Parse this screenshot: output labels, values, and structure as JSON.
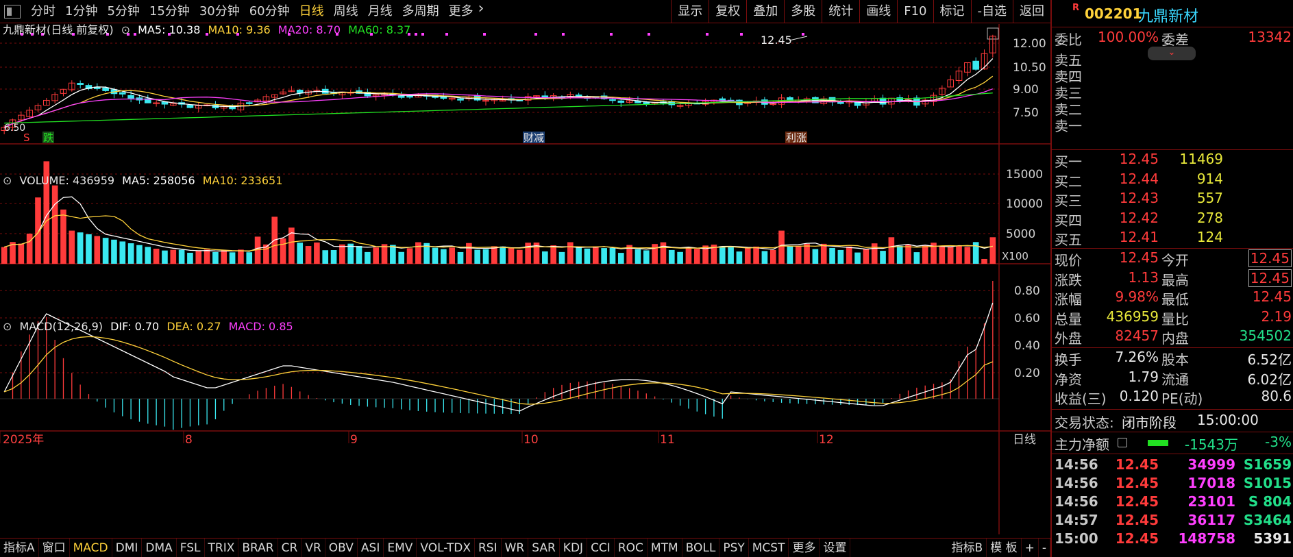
{
  "toolbar": {
    "periods": [
      "分时",
      "1分钟",
      "5分钟",
      "15分钟",
      "30分钟",
      "60分钟",
      "日线",
      "周线",
      "月线",
      "多周期",
      "更多"
    ],
    "active_period": "日线",
    "actions": [
      "显示",
      "复权",
      "叠加",
      "多股",
      "统计",
      "画线",
      "F10",
      "标记",
      "-自选",
      "返回"
    ]
  },
  "price_pane": {
    "title": "九鼎新材(日线 前复权)",
    "ma5": "MA5: 10.38",
    "ma10": "MA10: 9.36",
    "ma20": "MA20: 8.70",
    "ma60": "MA60: 8.37",
    "y_ticks": [
      "12.00",
      "10.50",
      "9.00",
      "7.50"
    ],
    "high_label": "12.45",
    "low_label": "6.50",
    "markers": [
      "S",
      "跌",
      "财减",
      "利涨"
    ]
  },
  "volume_pane": {
    "title": "VOLUME: 436959",
    "ma5": "MA5: 258056",
    "ma10": "MA10: 233651",
    "y_ticks": [
      "15000",
      "10000",
      "5000"
    ],
    "unit": "X100"
  },
  "macd_pane": {
    "title": "MACD(12,26,9)",
    "dif": "DIF: 0.70",
    "dea": "DEA: 0.27",
    "macd": "MACD: 0.85",
    "y_ticks": [
      "0.80",
      "0.60",
      "0.40",
      "0.20"
    ]
  },
  "x_axis": {
    "labels": [
      "2025年",
      "8",
      "9",
      "10",
      "11",
      "12"
    ],
    "period_label": "日线"
  },
  "bottom_tabs": [
    "指标A",
    "窗口",
    "MACD",
    "DMI",
    "DMA",
    "FSL",
    "TRIX",
    "BRAR",
    "CR",
    "VR",
    "OBV",
    "ASI",
    "EMV",
    "VOL-TDX",
    "RSI",
    "WR",
    "SAR",
    "KDJ",
    "CCI",
    "ROC",
    "MTM",
    "BOLL",
    "PSY",
    "MCST",
    "更多",
    "设置"
  ],
  "bottom_active": "MACD",
  "bottom_right": [
    "指标B",
    "模 板",
    "+",
    "-"
  ],
  "stock": {
    "badge": "R",
    "code": "002201",
    "name": "九鼎新材"
  },
  "order_ratio": {
    "label1": "委比",
    "value1": "100.00%",
    "label2": "委差",
    "value2": "13342"
  },
  "asks": [
    {
      "label": "卖五",
      "price": "",
      "vol": ""
    },
    {
      "label": "卖四",
      "price": "",
      "vol": ""
    },
    {
      "label": "卖三",
      "price": "",
      "vol": ""
    },
    {
      "label": "卖二",
      "price": "",
      "vol": ""
    },
    {
      "label": "卖一",
      "price": "",
      "vol": ""
    }
  ],
  "bids": [
    {
      "label": "买一",
      "price": "12.45",
      "vol": "11469"
    },
    {
      "label": "买二",
      "price": "12.44",
      "vol": "914"
    },
    {
      "label": "买三",
      "price": "12.43",
      "vol": "557"
    },
    {
      "label": "买四",
      "price": "12.42",
      "vol": "278"
    },
    {
      "label": "买五",
      "price": "12.41",
      "vol": "124"
    }
  ],
  "quote": [
    {
      "l1": "现价",
      "v1": "12.45",
      "l2": "今开",
      "v2": "12.45"
    },
    {
      "l1": "涨跌",
      "v1": "1.13",
      "l2": "最高",
      "v2": "12.45"
    },
    {
      "l1": "涨幅",
      "v1": "9.98%",
      "l2": "最低",
      "v2": "12.45"
    },
    {
      "l1": "总量",
      "v1": "436959",
      "l2": "量比",
      "v2": "2.19"
    },
    {
      "l1": "外盘",
      "v1": "82457",
      "l2": "内盘",
      "v2": "354502"
    }
  ],
  "fundamentals": [
    {
      "l1": "换手",
      "v1": "7.26%",
      "l2": "股本",
      "v2": "6.52亿"
    },
    {
      "l1": "净资",
      "v1": "1.79",
      "l2": "流通",
      "v2": "6.02亿"
    },
    {
      "l1": "收益(三)",
      "v1": "0.120",
      "l2": "PE(动)",
      "v2": "80.6"
    }
  ],
  "trade_status": {
    "label": "交易状态:",
    "value": "闭市阶段",
    "time": "15:00:00"
  },
  "main_flow": {
    "label": "主力净额",
    "value": "-1543万",
    "pct": "-3%"
  },
  "ticks": [
    {
      "time": "14:56",
      "price": "12.45",
      "vol": "34999",
      "flag": "S1659"
    },
    {
      "time": "14:56",
      "price": "12.45",
      "vol": "17018",
      "flag": "S1015"
    },
    {
      "time": "14:56",
      "price": "12.45",
      "vol": "23101",
      "flag": "S  804"
    },
    {
      "time": "14:57",
      "price": "12.45",
      "vol": "36117",
      "flag": "S3464"
    },
    {
      "time": "15:00",
      "price": "12.45",
      "vol": "148758",
      "flag": "5391"
    }
  ],
  "colors": {
    "up": "#ff3b3b",
    "down": "#3ae8f0",
    "ma5": "#ffffff",
    "ma10": "#ffd23a",
    "ma20": "#ff40ff",
    "ma60": "#22e022",
    "grid": "#7a0d0d"
  }
}
